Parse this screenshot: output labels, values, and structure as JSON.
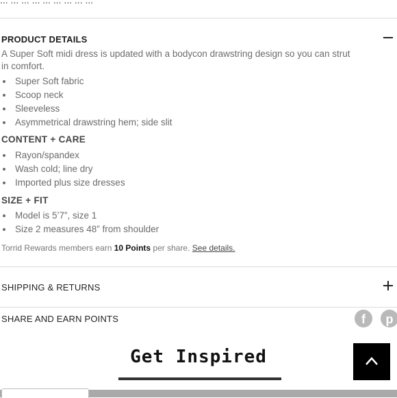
{
  "top_cut_text": "...  ...  ... ... ... ...  ...  ...  ...",
  "product_details": {
    "title": "PRODUCT DETAILS",
    "toggle": "−",
    "description_line1": "A Super Soft midi dress is updated with a bodycon drawstring design so you can strut",
    "description_line2": "in comfort.",
    "features": [
      "Super Soft fabric",
      "Scoop neck",
      "Sleeveless",
      "Asymmetrical drawstring hem; side slit"
    ],
    "content_care_title": "CONTENT + CARE",
    "content_care": [
      "Rayon/spandex",
      "Wash cold; line dry",
      "Imported plus size dresses"
    ],
    "size_fit_title": "SIZE + FIT",
    "size_fit": [
      "Model is 5’7”, size 1",
      "Size 2 measures 48” from shoulder"
    ],
    "rewards_prefix": "Torrid Rewards members earn ",
    "rewards_points": "10 Points",
    "rewards_suffix": " per share. ",
    "rewards_link": "See details."
  },
  "shipping": {
    "title": "SHIPPING & RETURNS",
    "toggle": "+"
  },
  "share": {
    "title": "SHARE AND EARN POINTS",
    "icons": [
      "facebook-icon",
      "pinterest-icon"
    ]
  },
  "inspired": {
    "title": "Get Inspired"
  },
  "back_to_top": {
    "icon": "chevron-up-icon"
  },
  "colors": {
    "accent_black": "#000000",
    "text_gray": "#6b6b6b",
    "divider": "#dcdcdc",
    "social_gray": "#b9b9b9"
  }
}
